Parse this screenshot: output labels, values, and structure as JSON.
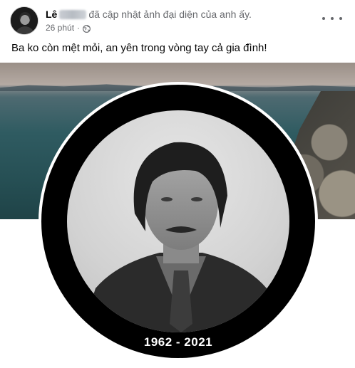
{
  "post": {
    "author_first": "Lê",
    "action_text": "đã cập nhật ảnh đại diện của anh ấy.",
    "time": "26 phút",
    "separator": "·",
    "privacy_icon": "globe-icon",
    "more_icon": "more-options-icon",
    "text": "Ba ko còn mệt mỏi, an yên trong vòng tay cả gia đình!"
  },
  "profile_photo": {
    "caption": "1962 - 2021"
  },
  "colors": {
    "text_primary": "#050505",
    "text_secondary": "#65676b",
    "frame": "#000000"
  }
}
